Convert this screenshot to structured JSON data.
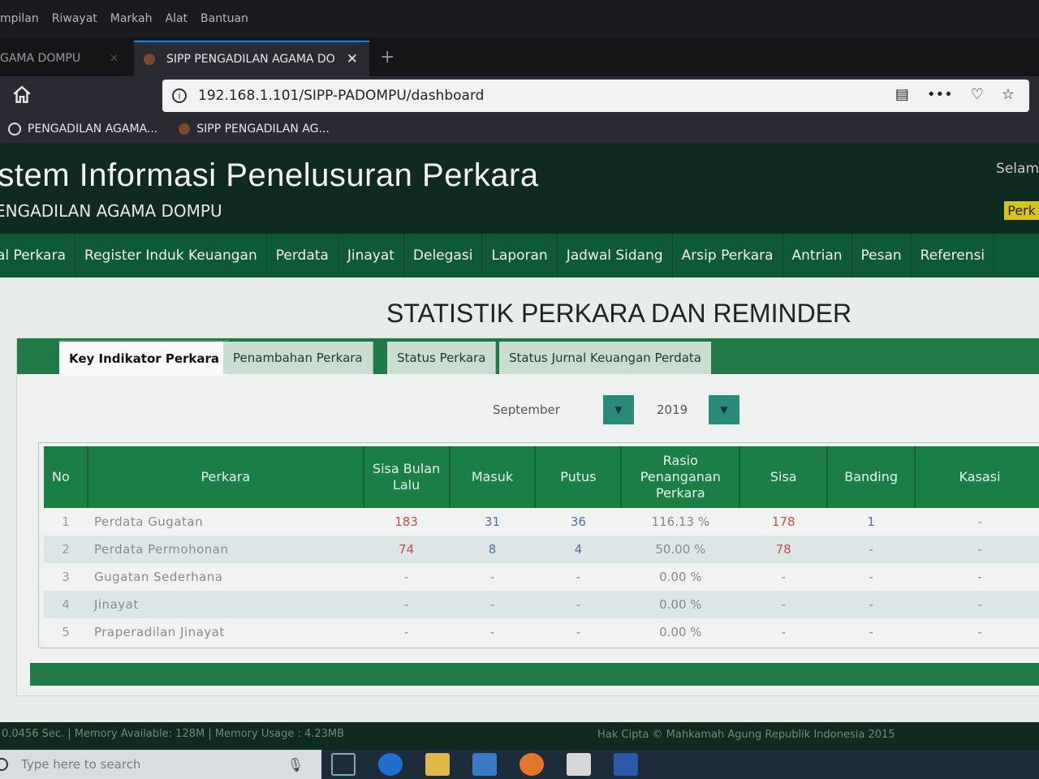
{
  "browser": {
    "menu": [
      "mpilan",
      "Riwayat",
      "Markah",
      "Alat",
      "Bantuan"
    ],
    "tabs": [
      {
        "label": "GAMA DOMPU"
      },
      {
        "label": "SIPP PENGADILAN AGAMA DO"
      }
    ],
    "url": "192.168.1.101/SIPP-PADOMPU/dashboard",
    "bookmarks": [
      {
        "label": "PENGADILAN AGAMA..."
      },
      {
        "label": "SIPP PENGADILAN AG..."
      }
    ]
  },
  "header": {
    "title": "istem Informasi Penelusuran Perkara",
    "subtitle": "ENGADILAN AGAMA DOMPU",
    "welcome": "Selam",
    "badge": "Perk"
  },
  "nav": [
    "al Perkara",
    "Register Induk Keuangan",
    "Perdata",
    "Jinayat",
    "Delegasi",
    "Laporan",
    "Jadwal Sidang",
    "Arsip Perkara",
    "Antrian",
    "Pesan",
    "Referensi"
  ],
  "page": {
    "title": "STATISTIK PERKARA DAN REMINDER",
    "tabs": [
      "Key Indikator Perkara",
      "Penambahan Perkara",
      "Status Perkara",
      "Status Jurnal Keuangan Perdata"
    ],
    "filter": {
      "month": "September",
      "year": "2019"
    }
  },
  "table": {
    "headers": [
      "No",
      "Perkara",
      "Sisa Bulan Lalu",
      "Masuk",
      "Putus",
      "Rasio Penanganan Perkara",
      "Sisa",
      "Banding",
      "Kasasi"
    ],
    "rows": [
      {
        "no": "1",
        "perkara": "Perdata Gugatan",
        "sisa_bulan_lalu": "183",
        "masuk": "31",
        "putus": "36",
        "rasio": "116.13 %",
        "sisa": "178",
        "banding": "1",
        "kasasi": "-"
      },
      {
        "no": "2",
        "perkara": "Perdata Permohonan",
        "sisa_bulan_lalu": "74",
        "masuk": "8",
        "putus": "4",
        "rasio": "50.00 %",
        "sisa": "78",
        "banding": "-",
        "kasasi": "-"
      },
      {
        "no": "3",
        "perkara": "Gugatan Sederhana",
        "sisa_bulan_lalu": "-",
        "masuk": "-",
        "putus": "-",
        "rasio": "0.00 %",
        "sisa": "-",
        "banding": "-",
        "kasasi": "-"
      },
      {
        "no": "4",
        "perkara": "Jinayat",
        "sisa_bulan_lalu": "-",
        "masuk": "-",
        "putus": "-",
        "rasio": "0.00 %",
        "sisa": "-",
        "banding": "-",
        "kasasi": "-"
      },
      {
        "no": "5",
        "perkara": "Praperadilan Jinayat",
        "sisa_bulan_lalu": "-",
        "masuk": "-",
        "putus": "-",
        "rasio": "0.00 %",
        "sisa": "-",
        "banding": "-",
        "kasasi": "-"
      }
    ]
  },
  "footer": {
    "stats": "0.0456 Sec. | Memory Available: 128M | Memory Usage : 4.23MB",
    "copyright": "Hak Cipta © Mahkamah Agung Republik Indonesia 2015"
  },
  "taskbar": {
    "search_placeholder": "Type here to search",
    "icons": [
      "task-view-icon",
      "edge-icon",
      "file-explorer-icon",
      "store-icon",
      "firefox-icon",
      "mail-icon",
      "word-icon"
    ]
  },
  "colors": {
    "accent": "#1b7f45",
    "header": "#0f2a1e",
    "nav": "#0f5a36",
    "dropdown": "#2a8a7a"
  }
}
